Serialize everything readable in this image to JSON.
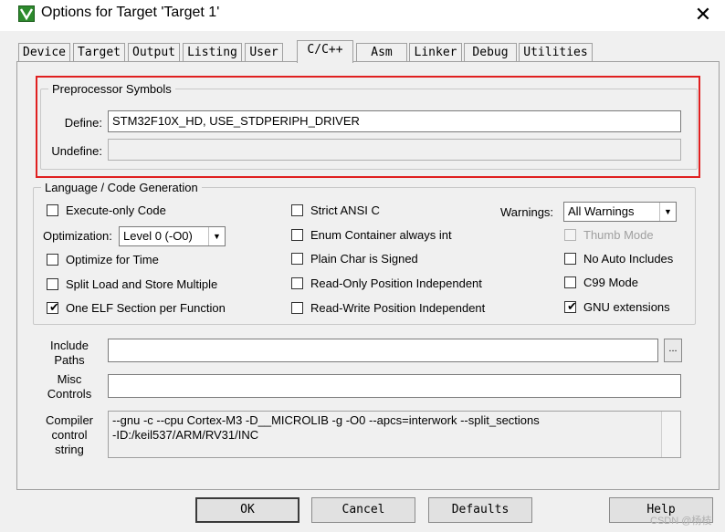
{
  "window": {
    "title": "Options for Target 'Target 1'",
    "icon": "keil-uvision-icon",
    "close_glyph": "✕"
  },
  "tabs": [
    {
      "label": "Device"
    },
    {
      "label": "Target"
    },
    {
      "label": "Output"
    },
    {
      "label": "Listing"
    },
    {
      "label": "User"
    },
    {
      "label": "C/C++",
      "active": true
    },
    {
      "label": "Asm"
    },
    {
      "label": "Linker"
    },
    {
      "label": "Debug"
    },
    {
      "label": "Utilities"
    }
  ],
  "preprocessor": {
    "legend": "Preprocessor Symbols",
    "define_label": "Define:",
    "define_value": "STM32F10X_HD, USE_STDPERIPH_DRIVER",
    "undefine_label": "Undefine:",
    "undefine_value": ""
  },
  "language": {
    "legend": "Language / Code Generation",
    "execute_only": {
      "label": "Execute-only Code",
      "checked": false
    },
    "optimization_label": "Optimization:",
    "optimization_value": "Level 0 (-O0)",
    "optimize_time": {
      "label": "Optimize for Time",
      "checked": false
    },
    "split_load": {
      "label": "Split Load and Store Multiple",
      "checked": false
    },
    "one_elf": {
      "label": "One ELF Section per Function",
      "checked": true
    },
    "strict_ansi": {
      "label": "Strict ANSI C",
      "checked": false
    },
    "enum_container": {
      "label": "Enum Container always int",
      "checked": false
    },
    "plain_char": {
      "label": "Plain Char is Signed",
      "checked": false
    },
    "ro_position": {
      "label": "Read-Only Position Independent",
      "checked": false
    },
    "rw_position": {
      "label": "Read-Write Position Independent",
      "checked": false
    },
    "warnings_label": "Warnings:",
    "warnings_value": "All Warnings",
    "thumb_mode": {
      "label": "Thumb Mode",
      "checked": false,
      "disabled": true
    },
    "no_auto_includes": {
      "label": "No Auto Includes",
      "checked": false
    },
    "c99_mode": {
      "label": "C99 Mode",
      "checked": false
    },
    "gnu_extensions": {
      "label": "GNU extensions",
      "checked": true
    }
  },
  "include_paths": {
    "label_line1": "Include",
    "label_line2": "Paths",
    "value": "",
    "browse_label": "..."
  },
  "misc_controls": {
    "label_line1": "Misc",
    "label_line2": "Controls",
    "value": ""
  },
  "compiler_string": {
    "label_line1": "Compiler",
    "label_line2": "control",
    "label_line3": "string",
    "line1": "--gnu -c --cpu Cortex-M3 -D__MICROLIB -g -O0 --apcs=interwork --split_sections",
    "line2": "-ID:/keil537/ARM/RV31/INC"
  },
  "buttons": {
    "ok": "OK",
    "cancel": "Cancel",
    "defaults": "Defaults",
    "help": "Help"
  },
  "watermark": "CSDN @杨枝"
}
